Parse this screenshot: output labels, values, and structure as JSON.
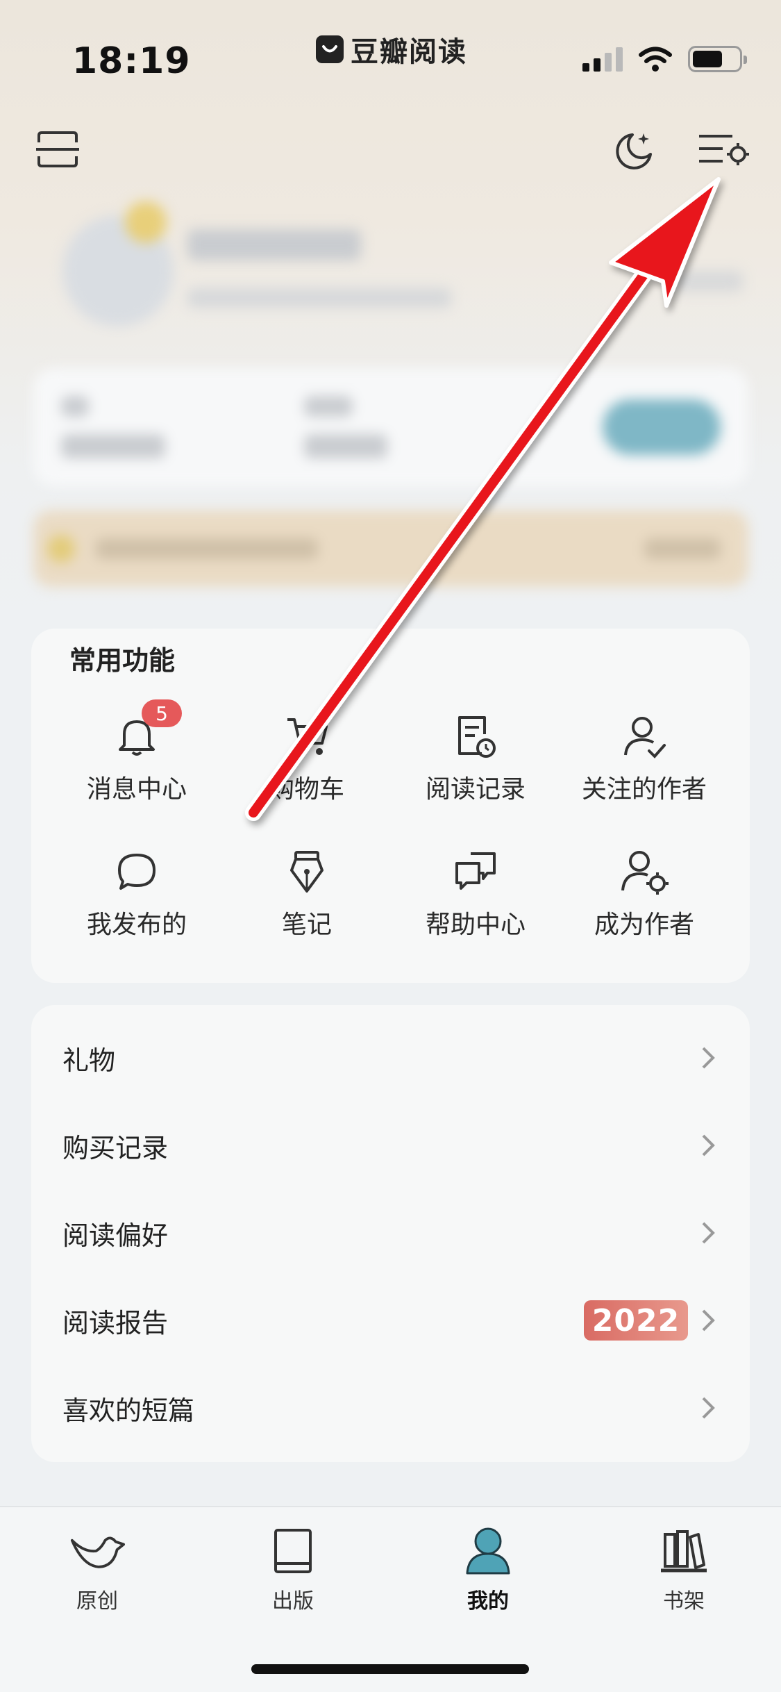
{
  "status_bar": {
    "time": "18:19",
    "app_name": "豆瓣阅读"
  },
  "top_bar": {
    "scan_icon": "scan-icon",
    "night_mode_icon": "moon-stars-icon",
    "settings_icon": "settings-menu-icon"
  },
  "common_functions": {
    "title": "常用功能",
    "items": [
      {
        "label": "消息中心",
        "icon": "bell-icon",
        "badge": "5"
      },
      {
        "label": "购物车",
        "icon": "cart-icon"
      },
      {
        "label": "阅读记录",
        "icon": "reading-history-icon"
      },
      {
        "label": "关注的作者",
        "icon": "followed-author-icon"
      },
      {
        "label": "我发布的",
        "icon": "chat-bubble-icon"
      },
      {
        "label": "笔记",
        "icon": "pen-nib-icon"
      },
      {
        "label": "帮助中心",
        "icon": "help-chat-icon"
      },
      {
        "label": "成为作者",
        "icon": "author-settings-icon"
      }
    ]
  },
  "menu_list": [
    {
      "label": "礼物"
    },
    {
      "label": "购买记录"
    },
    {
      "label": "阅读偏好"
    },
    {
      "label": "阅读报告",
      "badge": "2022"
    },
    {
      "label": "喜欢的短篇"
    }
  ],
  "tab_bar": [
    {
      "label": "原创",
      "icon": "bird-icon",
      "active": false
    },
    {
      "label": "出版",
      "icon": "book-icon",
      "active": false
    },
    {
      "label": "我的",
      "icon": "user-icon",
      "active": true
    },
    {
      "label": "书架",
      "icon": "bookshelf-icon",
      "active": false
    }
  ],
  "colors": {
    "accent": "#4fa3b6",
    "badge_red": "#e5595a",
    "arrow_red": "#e8161a"
  }
}
